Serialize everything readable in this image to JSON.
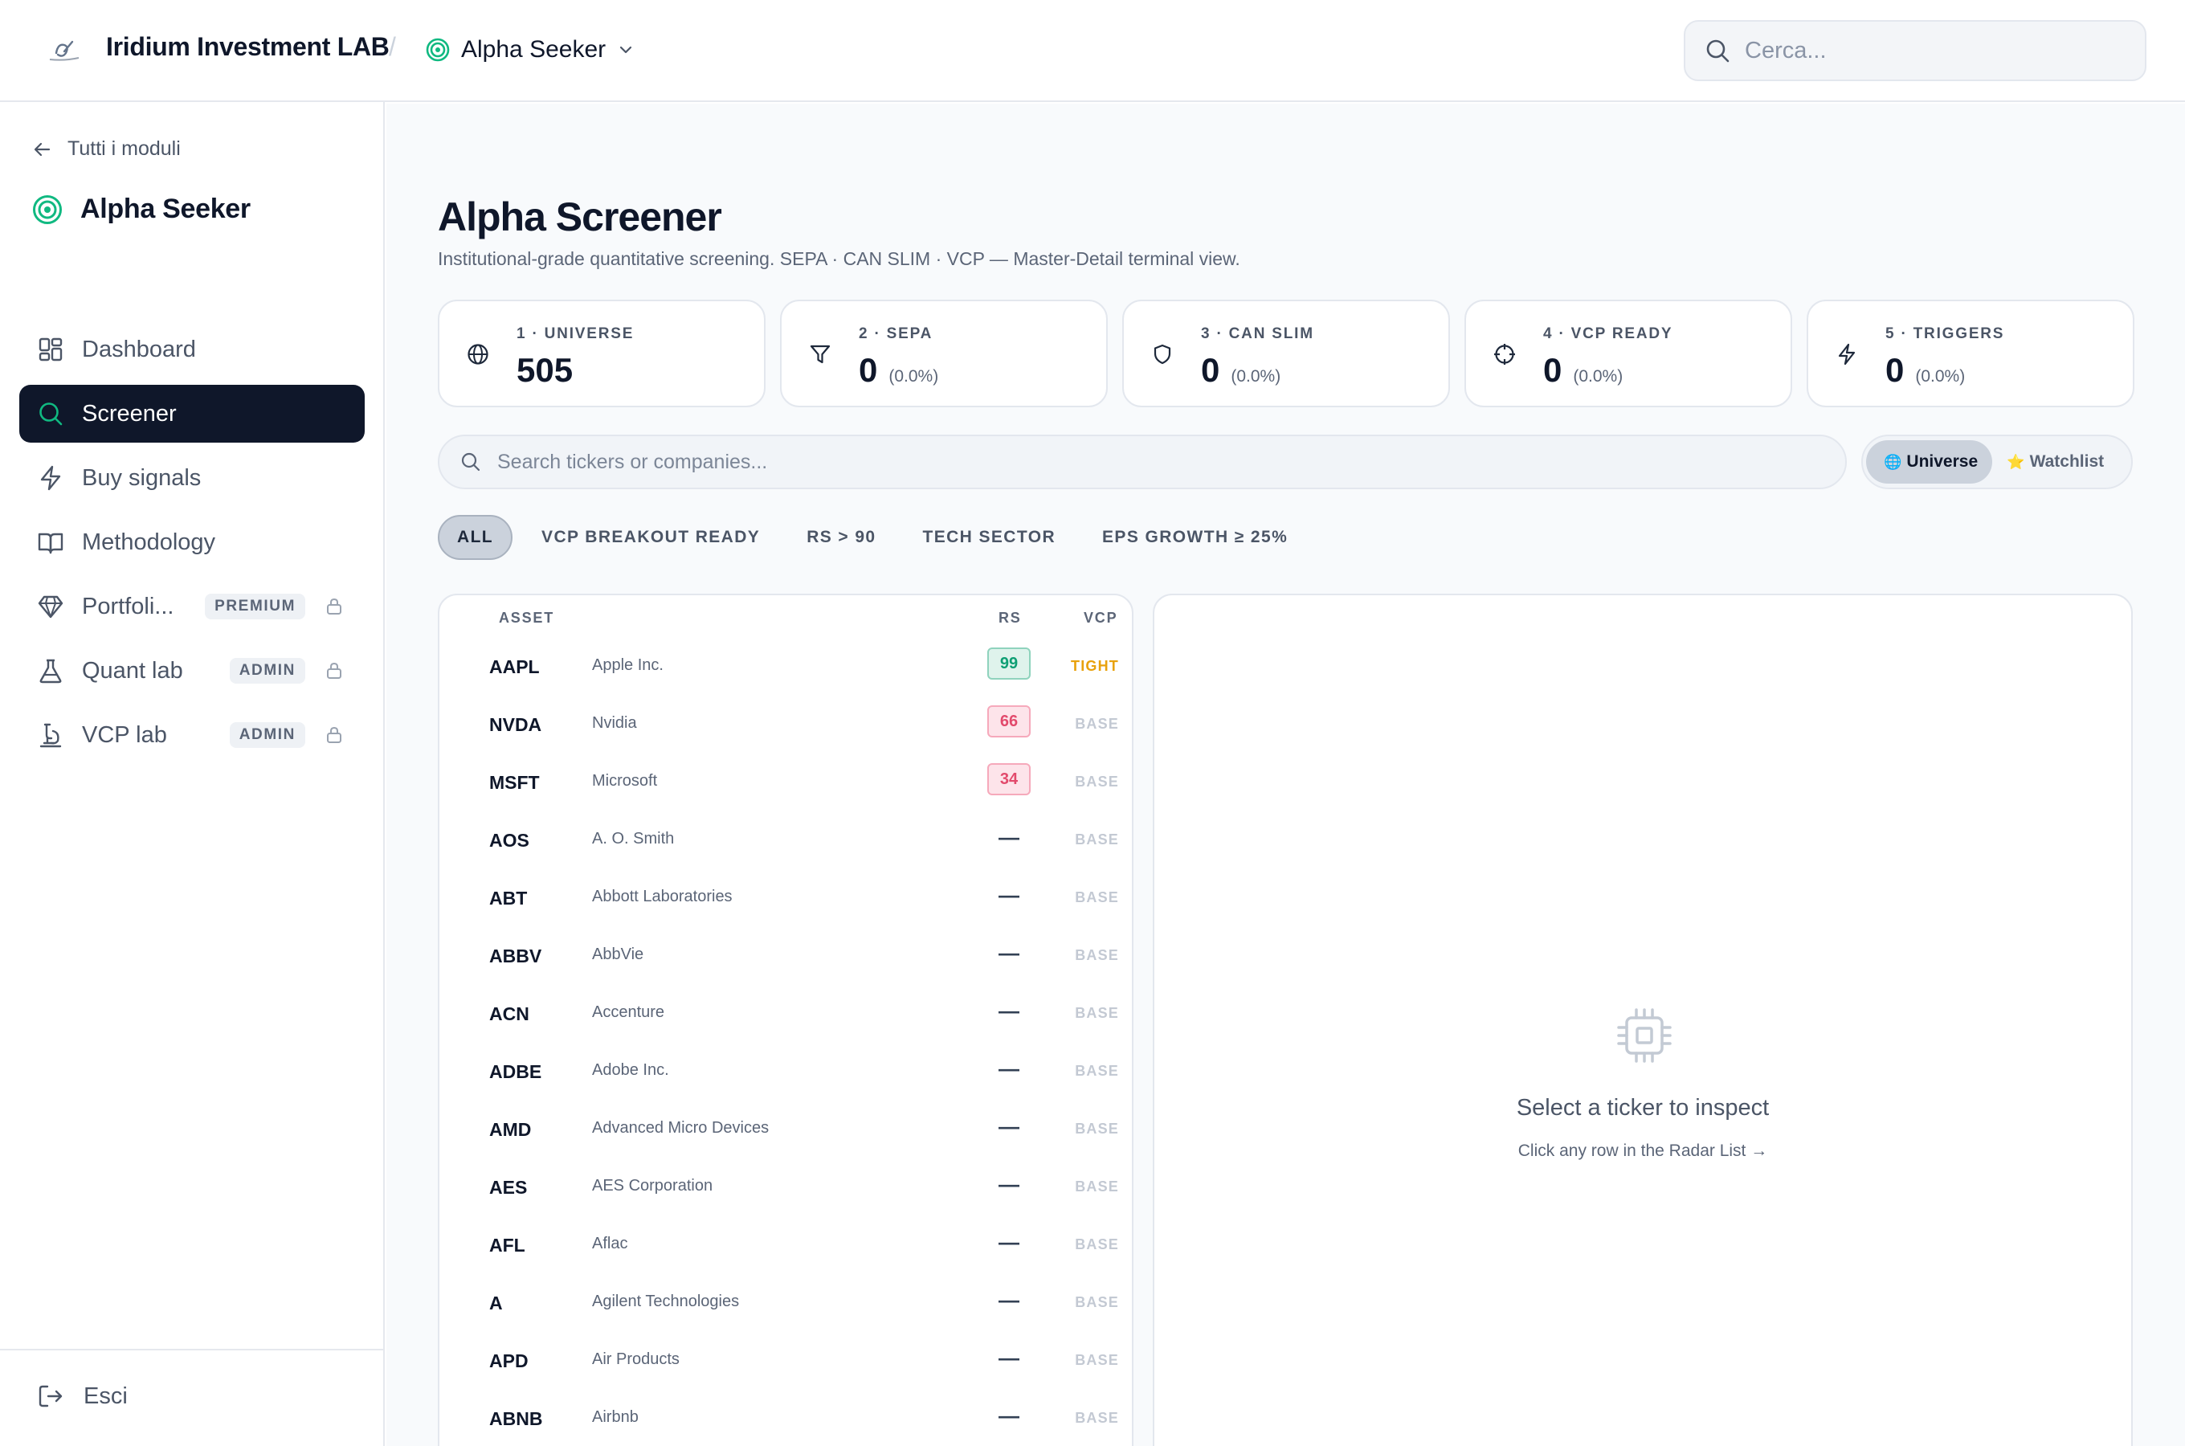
{
  "header": {
    "brand": "Iridium Investment LAB",
    "separator": "/",
    "module": "Alpha Seeker",
    "search_placeholder": "Cerca..."
  },
  "sidebar": {
    "back_label": "Tutti i moduli",
    "module_title": "Alpha Seeker",
    "items": [
      {
        "label": "Dashboard",
        "icon": "dashboard-icon",
        "active": false,
        "badge": ""
      },
      {
        "label": "Screener",
        "icon": "search-icon",
        "active": true,
        "badge": ""
      },
      {
        "label": "Buy signals",
        "icon": "lightning-icon",
        "active": false,
        "badge": ""
      },
      {
        "label": "Methodology",
        "icon": "book-icon",
        "active": false,
        "badge": ""
      },
      {
        "label": "Portfoli...",
        "icon": "gem-icon",
        "active": false,
        "badge": "PREMIUM",
        "locked": true
      },
      {
        "label": "Quant lab",
        "icon": "flask-icon",
        "active": false,
        "badge": "ADMIN",
        "locked": true
      },
      {
        "label": "VCP lab",
        "icon": "microscope-icon",
        "active": false,
        "badge": "ADMIN",
        "locked": true
      }
    ],
    "logout_label": "Esci"
  },
  "page": {
    "title": "Alpha Screener",
    "subtitle": "Institutional-grade quantitative screening. SEPA · CAN SLIM · VCP — Master-Detail terminal view."
  },
  "stats": [
    {
      "label": "1 · UNIVERSE",
      "value": "505",
      "pct": ""
    },
    {
      "label": "2 · SEPA",
      "value": "0",
      "pct": "(0.0%)"
    },
    {
      "label": "3 · CAN SLIM",
      "value": "0",
      "pct": "(0.0%)"
    },
    {
      "label": "4 · VCP READY",
      "value": "0",
      "pct": "(0.0%)"
    },
    {
      "label": "5 · TRIGGERS",
      "value": "0",
      "pct": "(0.0%)"
    }
  ],
  "search": {
    "placeholder": "Search tickers or companies..."
  },
  "view_toggle": {
    "universe_label": "Universe",
    "universe_emoji": "🌐",
    "watchlist_label": "Watchlist",
    "watchlist_emoji": "⭐",
    "active": "Universe"
  },
  "filters": [
    "ALL",
    "VCP BREAKOUT READY",
    "RS > 90",
    "TECH SECTOR",
    "EPS GROWTH ≥ 25%"
  ],
  "table": {
    "headers": {
      "asset": "ASSET",
      "rs": "RS",
      "vcp": "VCP"
    },
    "rows": [
      {
        "ticker": "AAPL",
        "company": "Apple Inc.",
        "rs": "99",
        "rs_level": "hi",
        "vcp": "TIGHT"
      },
      {
        "ticker": "NVDA",
        "company": "Nvidia",
        "rs": "66",
        "rs_level": "lo",
        "vcp": "BASE"
      },
      {
        "ticker": "MSFT",
        "company": "Microsoft",
        "rs": "34",
        "rs_level": "lo",
        "vcp": "BASE"
      },
      {
        "ticker": "AOS",
        "company": "A. O. Smith",
        "rs": "—",
        "rs_level": "none",
        "vcp": "BASE"
      },
      {
        "ticker": "ABT",
        "company": "Abbott Laboratories",
        "rs": "—",
        "rs_level": "none",
        "vcp": "BASE"
      },
      {
        "ticker": "ABBV",
        "company": "AbbVie",
        "rs": "—",
        "rs_level": "none",
        "vcp": "BASE"
      },
      {
        "ticker": "ACN",
        "company": "Accenture",
        "rs": "—",
        "rs_level": "none",
        "vcp": "BASE"
      },
      {
        "ticker": "ADBE",
        "company": "Adobe Inc.",
        "rs": "—",
        "rs_level": "none",
        "vcp": "BASE"
      },
      {
        "ticker": "AMD",
        "company": "Advanced Micro Devices",
        "rs": "—",
        "rs_level": "none",
        "vcp": "BASE"
      },
      {
        "ticker": "AES",
        "company": "AES Corporation",
        "rs": "—",
        "rs_level": "none",
        "vcp": "BASE"
      },
      {
        "ticker": "AFL",
        "company": "Aflac",
        "rs": "—",
        "rs_level": "none",
        "vcp": "BASE"
      },
      {
        "ticker": "A",
        "company": "Agilent Technologies",
        "rs": "—",
        "rs_level": "none",
        "vcp": "BASE"
      },
      {
        "ticker": "APD",
        "company": "Air Products",
        "rs": "—",
        "rs_level": "none",
        "vcp": "BASE"
      },
      {
        "ticker": "ABNB",
        "company": "Airbnb",
        "rs": "—",
        "rs_level": "none",
        "vcp": "BASE"
      }
    ]
  },
  "inspector": {
    "title": "Select a ticker to inspect",
    "subtitle": "Click any row in the Radar List →"
  },
  "colors": {
    "accent": "#10b981",
    "sidebar_active": "#0f172a",
    "rs_high": "#0e9f74",
    "rs_low": "#e24a6c",
    "vcp_tight": "#e8a10c"
  }
}
